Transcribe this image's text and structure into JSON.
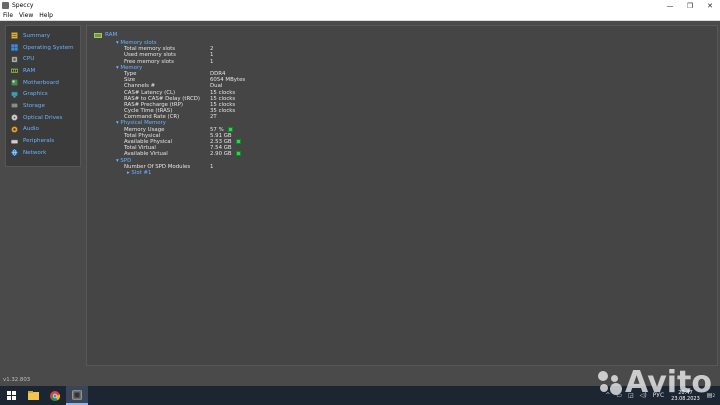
{
  "window": {
    "title": "Speccy",
    "minimize": "—",
    "maximize": "❐",
    "close": "✕"
  },
  "menu": [
    "File",
    "View",
    "Help"
  ],
  "sidebar": {
    "items": [
      {
        "label": "Summary",
        "icon": "summary-icon",
        "color": "#e0b23a"
      },
      {
        "label": "Operating System",
        "icon": "windows-icon",
        "color": "#3a8be0"
      },
      {
        "label": "CPU",
        "icon": "cpu-icon",
        "color": "#c8c8c8"
      },
      {
        "label": "RAM",
        "icon": "ram-icon",
        "color": "#6d9a3a"
      },
      {
        "label": "Motherboard",
        "icon": "motherboard-icon",
        "color": "#5b9a5b"
      },
      {
        "label": "Graphics",
        "icon": "graphics-icon",
        "color": "#3aa0b8"
      },
      {
        "label": "Storage",
        "icon": "storage-icon",
        "color": "#8a8a8a"
      },
      {
        "label": "Optical Drives",
        "icon": "optical-drive-icon",
        "color": "#c9c9c9"
      },
      {
        "label": "Audio",
        "icon": "audio-icon",
        "color": "#e0a23a"
      },
      {
        "label": "Peripherals",
        "icon": "peripherals-icon",
        "color": "#d0d0d0"
      },
      {
        "label": "Network",
        "icon": "network-icon",
        "color": "#3a8be0"
      }
    ]
  },
  "content": {
    "heading": "RAM",
    "memory_slots": {
      "title": "Memory slots",
      "rows": [
        {
          "key": "Total memory slots",
          "value": "2"
        },
        {
          "key": "Used memory slots",
          "value": "1"
        },
        {
          "key": "Free memory slots",
          "value": "1"
        }
      ]
    },
    "memory": {
      "title": "Memory",
      "rows": [
        {
          "key": "Type",
          "value": "DDR4"
        },
        {
          "key": "Size",
          "value": "6054 MBytes"
        },
        {
          "key": "Channels #",
          "value": "Dual"
        },
        {
          "key": "CAS# Latency (CL)",
          "value": "15 clocks"
        },
        {
          "key": "RAS# to CAS# Delay (tRCD)",
          "value": "15 clocks"
        },
        {
          "key": "RAS# Precharge (tRP)",
          "value": "15 clocks"
        },
        {
          "key": "Cycle Time (tRAS)",
          "value": "35 clocks"
        },
        {
          "key": "Command Rate (CR)",
          "value": "2T"
        }
      ]
    },
    "physical_memory": {
      "title": "Physical Memory",
      "rows": [
        {
          "key": "Memory Usage",
          "value": "57 %"
        },
        {
          "key": "Total Physical",
          "value": "5.91 GB"
        },
        {
          "key": "Available Physical",
          "value": "2.53 GB"
        },
        {
          "key": "Total Virtual",
          "value": "7.54 GB"
        },
        {
          "key": "Available Virtual",
          "value": "2.90 GB"
        }
      ]
    },
    "spd": {
      "title": "SPD",
      "rows": [
        {
          "key": "Number Of SPD Modules",
          "value": "1"
        }
      ],
      "slot": "Slot #1"
    }
  },
  "version": "v1.32.803",
  "taskbar": {
    "tray_lang": "РУС",
    "time": "20:47",
    "date": "23.08.2023",
    "notification_count": "2"
  },
  "watermark": "Avito"
}
